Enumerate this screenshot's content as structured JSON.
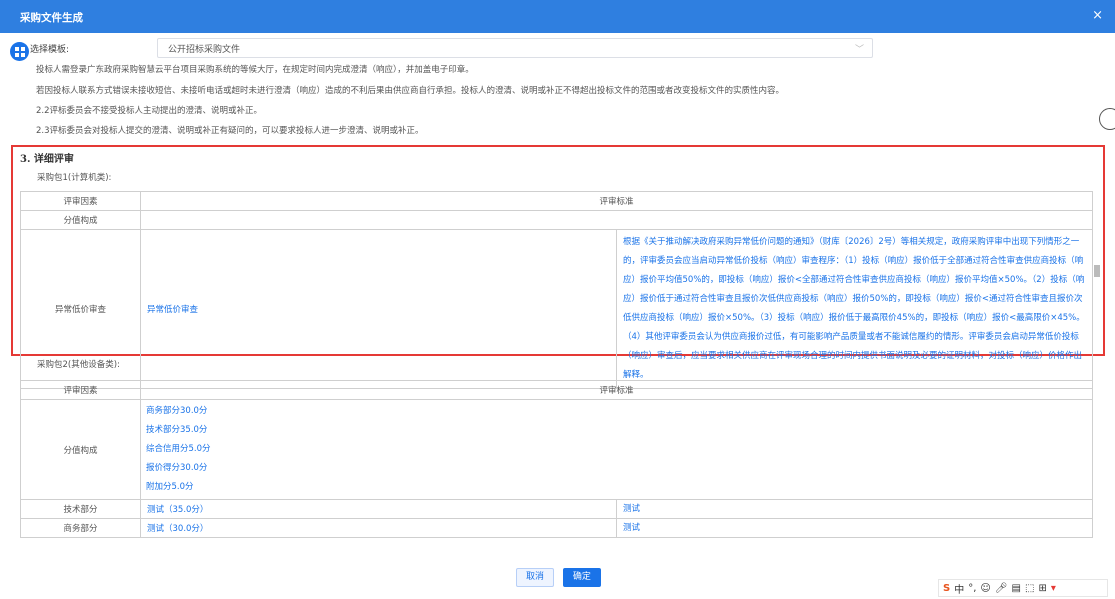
{
  "window": {
    "title": "采购文件生成",
    "close_glyph": "×"
  },
  "template": {
    "label": "选择模板:",
    "value": "公开招标采购文件"
  },
  "paragraphs": [
    "投标人需登录广东政府采购智慧云平台项目采购系统的等候大厅，在规定时间内完成澄清（响应），并加盖电子印章。",
    "若因投标人联系方式错误未接收短信、未接听电话或超时未进行澄清（响应）造成的不利后果由供应商自行承担。投标人的澄清、说明或补正不得超出投标文件的范围或者改变投标文件的实质性内容。",
    "2.2评标委员会不接受投标人主动提出的澄清、说明或补正。",
    "2.3评标委员会对投标人提交的澄清、说明或补正有疑问的，可以要求投标人进一步澄清、说明或补正。"
  ],
  "section_title": "3. 详细评审",
  "package1": {
    "label": "采购包1(计算机类):",
    "headers": [
      "评审因素",
      "评审标准"
    ],
    "row_score": "分值构成",
    "row_abnormal": {
      "factor": "异常低价审查",
      "item": "异常低价审查",
      "standard": "根据《关于推动解决政府采购异常低价问题的通知》（财库〔2026〕2号）等相关规定，政府采购评审中出现下列情形之一的，评审委员会应当启动异常低价投标（响应）审查程序：（1）投标（响应）报价低于全部通过符合性审查供应商投标（响应）报价平均值50%的，即投标（响应）报价<全部通过符合性审查供应商投标（响应）报价平均值×50%。（2）投标（响应）报价低于通过符合性审查且报价次低供应商投标（响应）报价50%的，即投标（响应）报价<通过符合性审查且报价次低供应商投标（响应）报价×50%。（3）投标（响应）报价低于最高限价45%的，即投标（响应）报价<最高限价×45%。（4）其他评审委员会认为供应商报价过低，有可能影响产品质量或者不能诚信履约的情形。评审委员会启动异常低价投标（响应）审查后，应当要求相关供应商在评审现场合理的时间内提供书面说明及必要的证明材料，对投标（响应）价格作出解释。"
    }
  },
  "package2": {
    "label": "采购包2(其他设备类):",
    "headers": [
      "评审因素",
      "评审标准"
    ],
    "score_label": "分值构成",
    "score_items": [
      "商务部分30.0分",
      "技术部分35.0分",
      "综合信用分5.0分",
      "报价得分30.0分",
      "附加分5.0分"
    ],
    "rows": [
      {
        "factor": "技术部分",
        "item": "测试（35.0分）",
        "standard": "测试"
      },
      {
        "factor": "商务部分",
        "item": "测试（30.0分）",
        "standard": "测试"
      }
    ]
  },
  "buttons": {
    "cancel": "取消",
    "ok": "确定"
  },
  "ime": {
    "logo": "S",
    "lang": "中",
    "punct": "°,",
    "icons": [
      "emoji-icon",
      "mic-icon",
      "keyboard-icon",
      "skin-icon",
      "apps-icon",
      "shirt-icon"
    ]
  }
}
